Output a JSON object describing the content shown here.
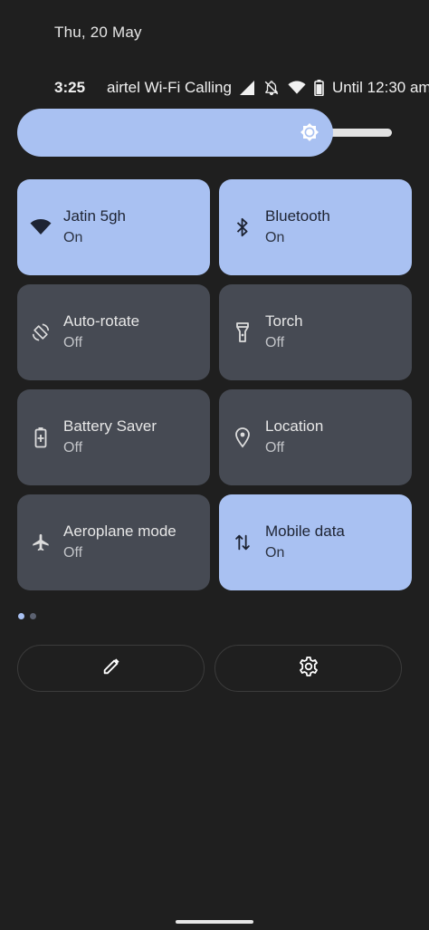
{
  "header": {
    "date": "Thu, 20 May"
  },
  "status_bar": {
    "time": "3:25",
    "carrier": "airtel Wi-Fi Calling",
    "battery_text": "Until 12:30 am",
    "icons": [
      "signal-icon",
      "mute-icon",
      "wifi-icon",
      "battery-icon"
    ]
  },
  "brightness": {
    "level": 0.8,
    "icon": "brightness-icon"
  },
  "tiles": [
    {
      "name": "Jatin 5gh",
      "state": "On",
      "icon": "wifi-icon"
    },
    {
      "name": "Bluetooth",
      "state": "On",
      "icon": "bluetooth-icon"
    },
    {
      "name": "Auto-rotate",
      "state": "Off",
      "icon": "auto-rotate-icon"
    },
    {
      "name": "Torch",
      "state": "Off",
      "icon": "torch-icon"
    },
    {
      "name": "Battery Saver",
      "state": "Off",
      "icon": "battery-saver-icon"
    },
    {
      "name": "Location",
      "state": "Off",
      "icon": "location-icon"
    },
    {
      "name": "Aeroplane mode",
      "state": "Off",
      "icon": "aeroplane-icon"
    },
    {
      "name": "Mobile data",
      "state": "On",
      "icon": "mobile-data-icon"
    }
  ],
  "pager": {
    "pages": 2,
    "current": 1
  },
  "footer": {
    "edit_icon": "edit-icon",
    "settings_icon": "settings-icon"
  },
  "colors": {
    "tile_on": "#a9c1f2",
    "tile_off": "#464a53",
    "background": "#1f1f1f"
  }
}
